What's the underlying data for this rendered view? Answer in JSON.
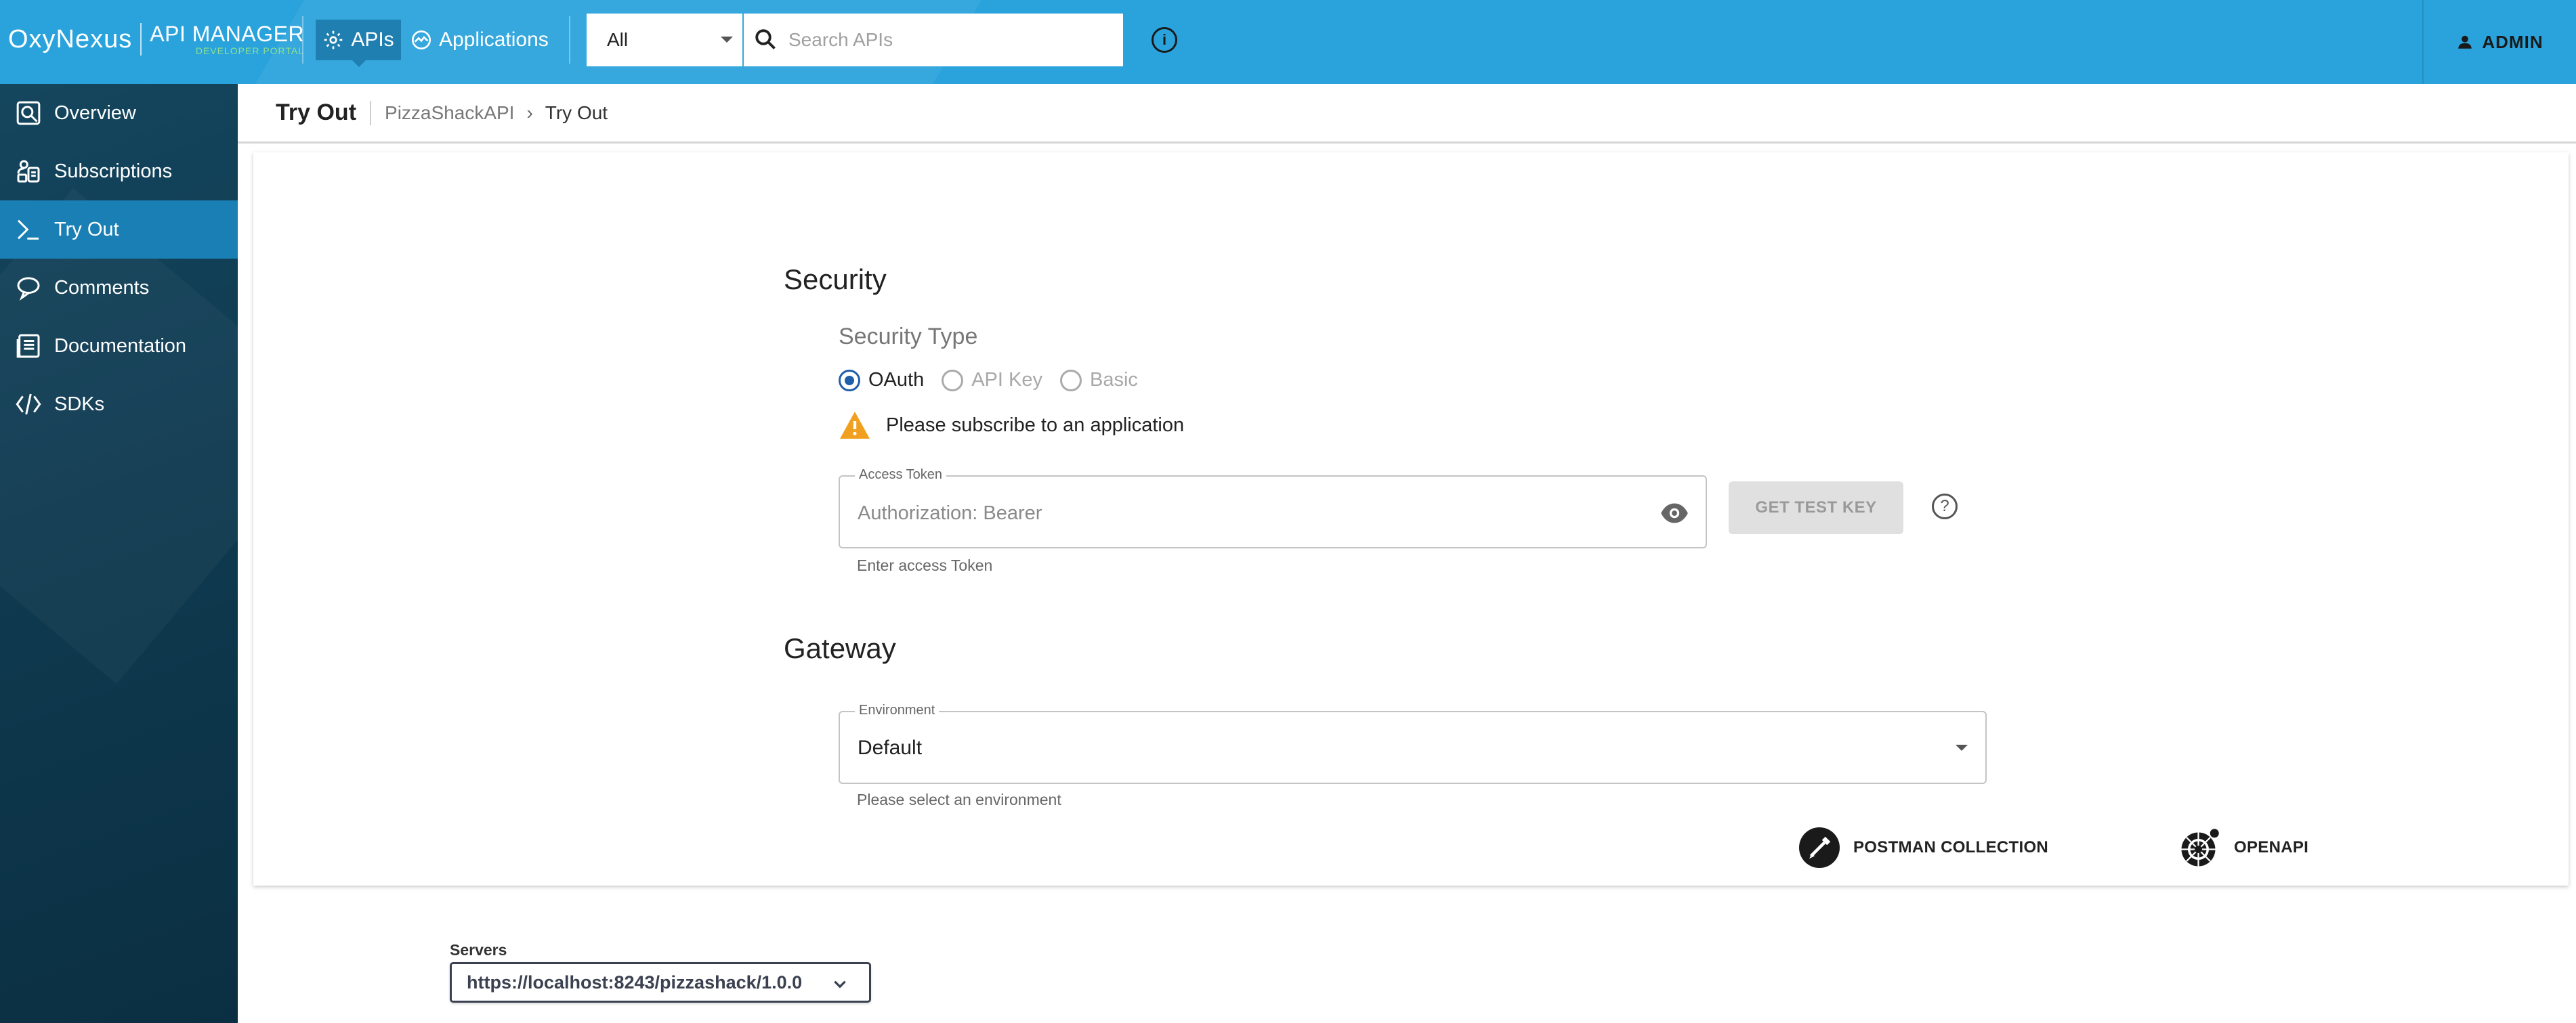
{
  "header": {
    "logo_text": "OxyNexus",
    "brand_title": "API MANAGER",
    "brand_subtitle": "DEVELOPER PORTAL",
    "nav": [
      {
        "label": "APIs",
        "icon": "gear-icon",
        "active": true
      },
      {
        "label": "Applications",
        "icon": "applications-icon",
        "active": false
      }
    ],
    "search_scope": "All",
    "search_placeholder": "Search APIs",
    "info_icon": "info-icon",
    "user_label": "ADMIN"
  },
  "sidebar": {
    "items": [
      {
        "label": "Overview",
        "icon": "overview-icon",
        "active": false
      },
      {
        "label": "Subscriptions",
        "icon": "subscriptions-icon",
        "active": false
      },
      {
        "label": "Try Out",
        "icon": "terminal-icon",
        "active": true
      },
      {
        "label": "Comments",
        "icon": "comments-icon",
        "active": false
      },
      {
        "label": "Documentation",
        "icon": "documentation-icon",
        "active": false
      },
      {
        "label": "SDKs",
        "icon": "code-icon",
        "active": false
      }
    ]
  },
  "breadcrumb": {
    "title": "Try Out",
    "api_name": "PizzaShackAPI",
    "current": "Try Out"
  },
  "security": {
    "heading": "Security",
    "type_label": "Security Type",
    "options": [
      {
        "label": "OAuth",
        "selected": true
      },
      {
        "label": "API Key",
        "selected": false
      },
      {
        "label": "Basic",
        "selected": false
      }
    ],
    "warning": "Please subscribe to an application",
    "access_token": {
      "legend": "Access Token",
      "placeholder": "Authorization: Bearer",
      "value": "",
      "helper": "Enter access Token"
    },
    "get_test_key_label": "GET TEST KEY"
  },
  "gateway": {
    "heading": "Gateway",
    "environment": {
      "legend": "Environment",
      "value": "Default",
      "helper": "Please select an environment"
    }
  },
  "downloads": {
    "postman_label": "POSTMAN COLLECTION",
    "openapi_label": "OPENAPI"
  },
  "servers": {
    "label": "Servers",
    "selected": "https://localhost:8243/pizzashack/1.0.0"
  },
  "colors": {
    "header_bg": "#2aa3dc",
    "sidebar_bg": "#0f3a50",
    "sidebar_active": "#1a7fb4",
    "radio_selected": "#1f5ea8",
    "warning": "#f0a01e"
  }
}
